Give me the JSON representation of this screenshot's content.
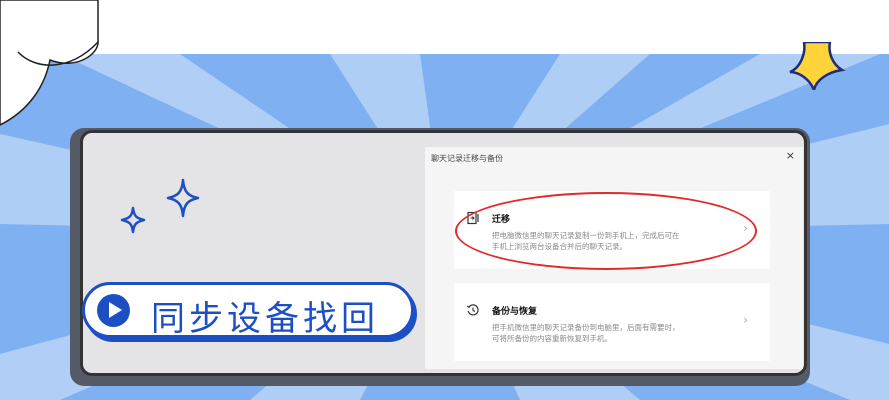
{
  "dialog": {
    "title": "聊天记录迁移与备份",
    "close_label": "×"
  },
  "cards": [
    {
      "title": "迁移",
      "icon": "phone-transfer-icon",
      "desc_line1": "把电脑微信里的聊天记录复制一份到手机上，完成后可在",
      "desc_line2": "手机上浏览两台设备合并后的聊天记录。",
      "chevron": "›"
    },
    {
      "title": "备份与恢复",
      "icon": "history-icon",
      "desc_line1": "把手机微信里的聊天记录备份到电脑里，后面有需要时，",
      "desc_line2": "可将所备份的内容重新恢复到手机。",
      "chevron": "›"
    }
  ],
  "banner": {
    "text": "同步设备找回",
    "icon": "play-icon"
  },
  "colors": {
    "background_blue": "#7fb0f1",
    "banner_blue": "#1d4fc4",
    "highlight_red": "#e12b2b",
    "sparkle_yellow": "#ffd43b"
  }
}
